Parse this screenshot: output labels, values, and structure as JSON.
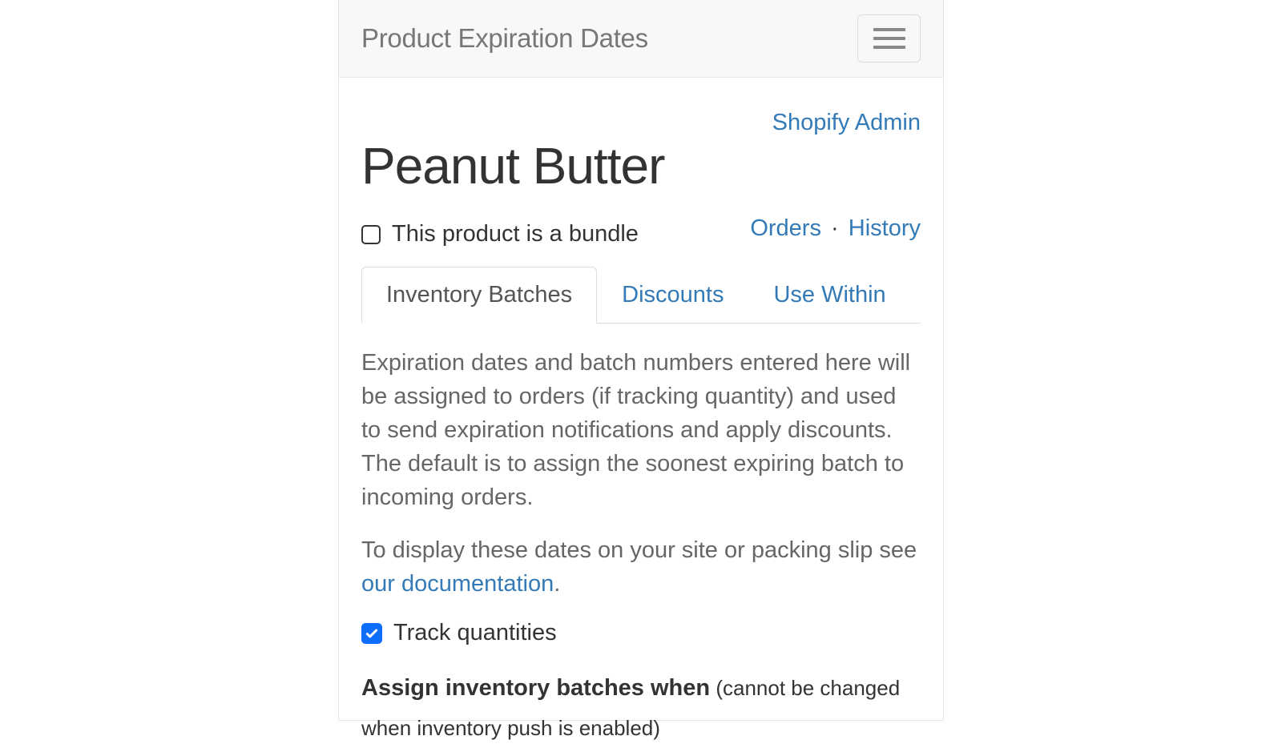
{
  "navbar": {
    "brand": "Product Expiration Dates"
  },
  "links": {
    "shopify_admin": "Shopify Admin",
    "orders": "Orders",
    "history": "History",
    "separator": "·",
    "documentation": "our documentation"
  },
  "product": {
    "title": "Peanut Butter",
    "bundle_label": "This product is a bundle",
    "bundle_checked": false
  },
  "tabs": {
    "inventory_batches": "Inventory Batches",
    "discounts": "Discounts",
    "use_within": "Use Within"
  },
  "description": {
    "p1": "Expiration dates and batch numbers entered here will be assigned to orders (if tracking quantity) and used to send expiration notifications and apply discounts. The default is to assign the soonest expiring batch to incoming orders.",
    "p2_prefix": "To display these dates on your site or packing slip see ",
    "p2_suffix": "."
  },
  "track": {
    "label": "Track quantities",
    "checked": true
  },
  "assign": {
    "bold": "Assign inventory batches when",
    "muted": " (cannot be changed when inventory push is enabled)"
  }
}
